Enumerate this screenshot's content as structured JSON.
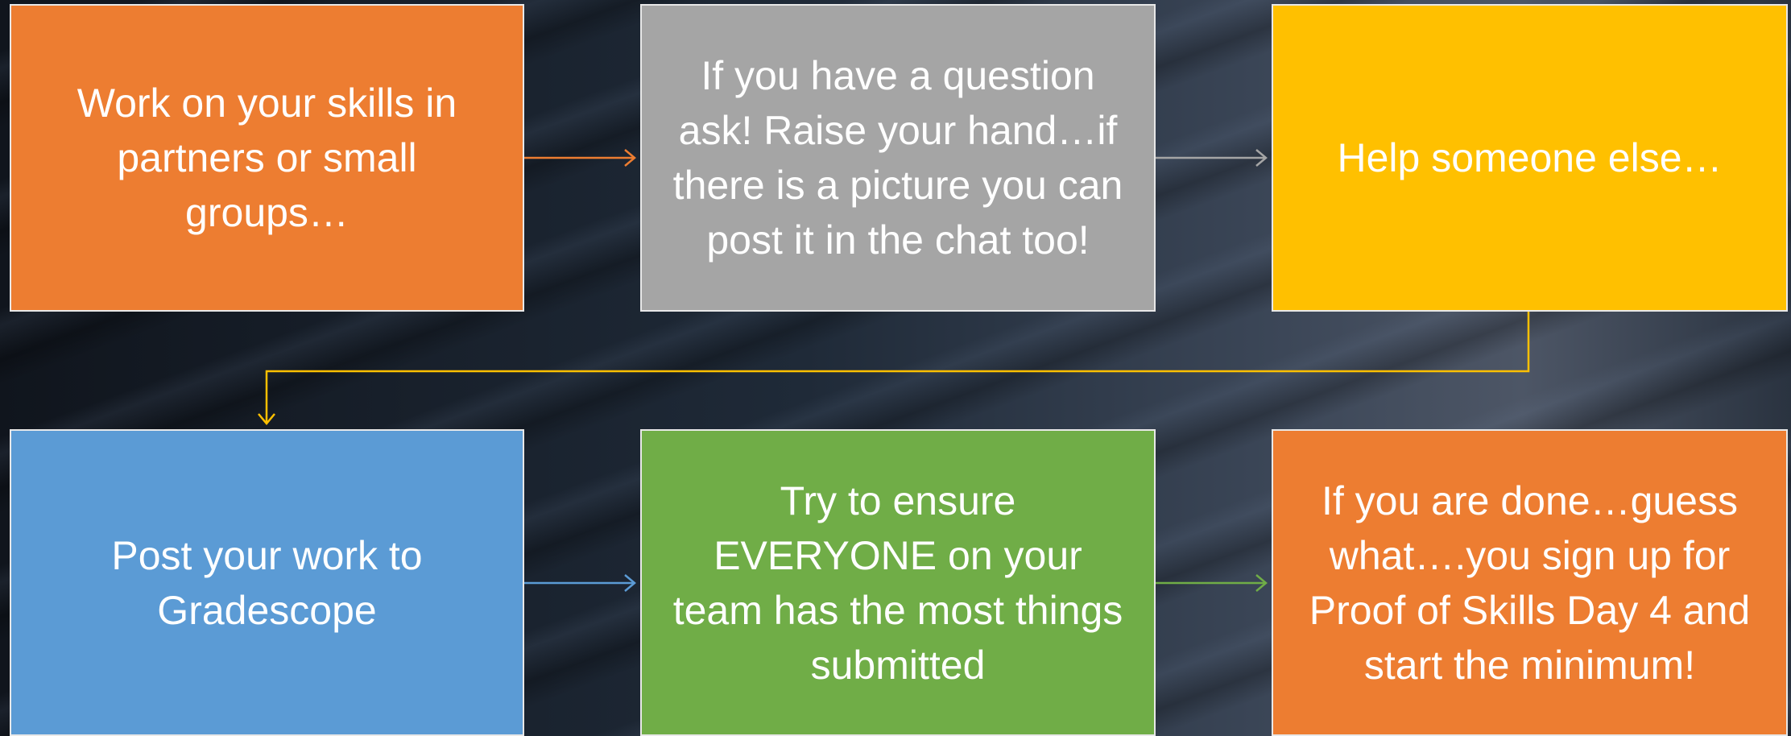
{
  "steps": [
    {
      "text": "Work on your skills in partners or small groups…",
      "color": "#ed7d31"
    },
    {
      "text": "If you have a question ask! Raise your hand…if there is a picture you can post it in the chat too!",
      "color": "#a5a5a5"
    },
    {
      "text": "Help someone else…",
      "color": "#ffc000"
    },
    {
      "text": "Post your work to Gradescope",
      "color": "#5b9bd5"
    },
    {
      "text": "Try to ensure EVERYONE on your team has the most things submitted",
      "color": "#70ad47"
    },
    {
      "text": "If you are done…guess what….you sign up for Proof of Skills Day 4 and start the minimum!",
      "color": "#ed7d31"
    }
  ],
  "arrows": [
    {
      "from": 1,
      "to": 2,
      "color": "#ed7d31"
    },
    {
      "from": 2,
      "to": 3,
      "color": "#a5a5a5"
    },
    {
      "from": 3,
      "to": 4,
      "color": "#ffc000"
    },
    {
      "from": 4,
      "to": 5,
      "color": "#5b9bd5"
    },
    {
      "from": 5,
      "to": 6,
      "color": "#70ad47"
    }
  ]
}
